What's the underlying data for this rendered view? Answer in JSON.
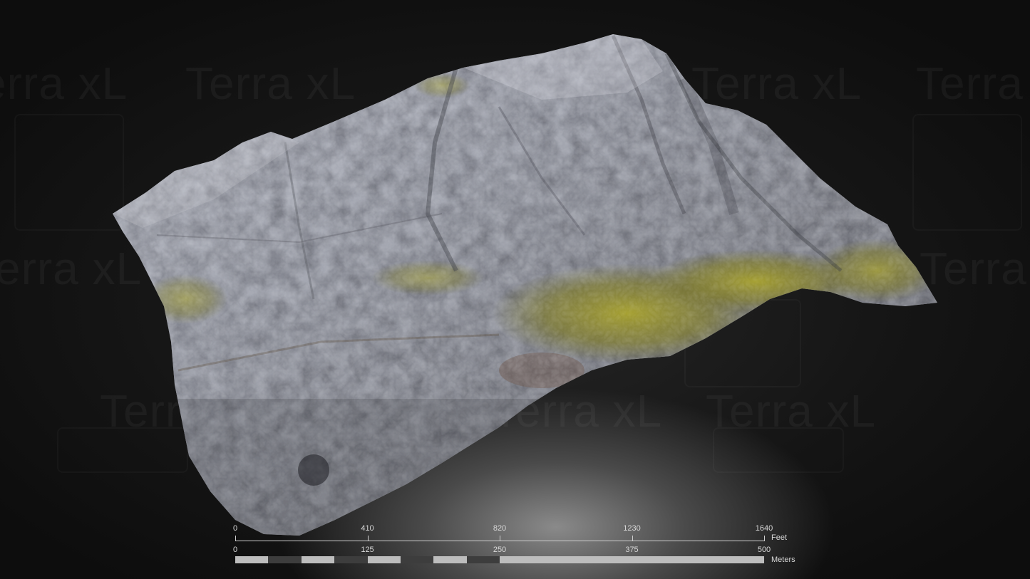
{
  "watermark": {
    "text": "Terra xL"
  },
  "scale_bar": {
    "feet": {
      "unit": "Feet",
      "ticks": [
        "0",
        "410",
        "820",
        "1230",
        "1640"
      ]
    },
    "meters": {
      "unit": "Meters",
      "ticks": [
        "0",
        "125",
        "250",
        "375",
        "500"
      ]
    }
  },
  "colors": {
    "background": "#141414",
    "rock": "#9a9ca4",
    "moss": "#8e8a2a",
    "scale": "#cfcfcf"
  }
}
